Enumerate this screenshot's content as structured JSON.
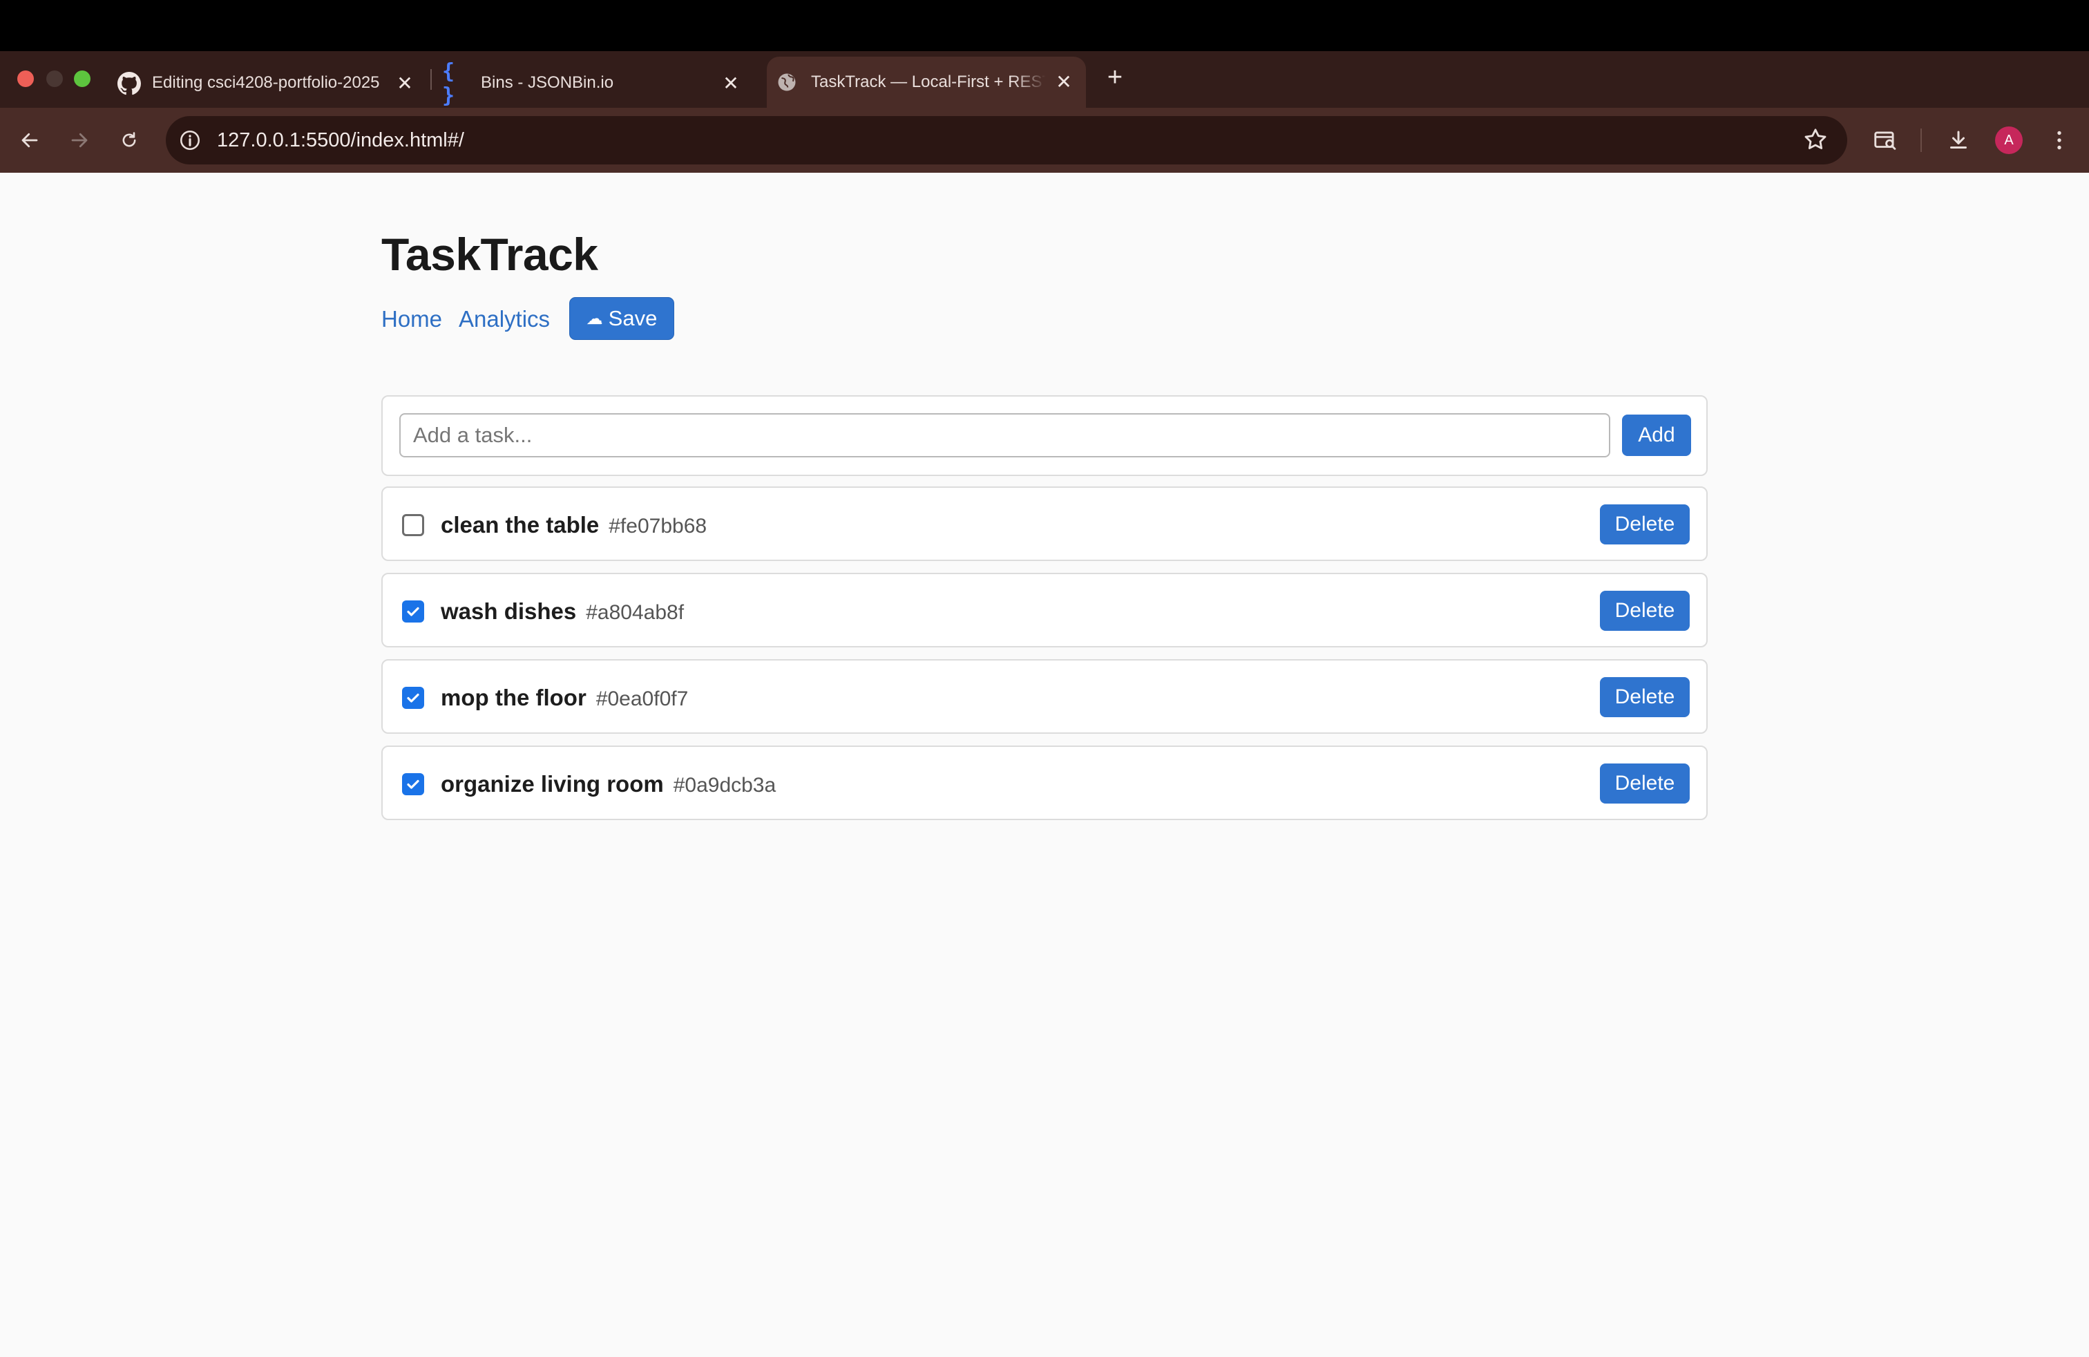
{
  "browser": {
    "tabs": [
      {
        "title": "Editing csci4208-portfolio-2025",
        "icon": "github-icon"
      },
      {
        "title": "Bins - JSONBin.io",
        "icon": "braces-icon"
      },
      {
        "title": "TaskTrack — Local-First + REST",
        "icon": "globe-icon",
        "active": true
      }
    ],
    "close_glyph": "✕",
    "new_tab_glyph": "+",
    "url": "127.0.0.1:5500/index.html#/",
    "profile_initial": "A",
    "accent": "#4a2c27"
  },
  "app": {
    "title": "TaskTrack",
    "nav": {
      "home": "Home",
      "analytics": "Analytics",
      "save_icon": "☁",
      "save_label": "Save"
    },
    "add_form": {
      "placeholder": "Add a task...",
      "value": "",
      "add_label": "Add"
    },
    "tasks": [
      {
        "name": "clean the table",
        "id": "#fe07bb68",
        "done": false
      },
      {
        "name": "wash dishes",
        "id": "#a804ab8f",
        "done": true
      },
      {
        "name": "mop the floor",
        "id": "#0ea0f0f7",
        "done": true
      },
      {
        "name": "organize living room",
        "id": "#0a9dcb3a",
        "done": true
      }
    ],
    "delete_label": "Delete",
    "primary_color": "#2f74cf",
    "link_color": "#2e6fc4"
  }
}
